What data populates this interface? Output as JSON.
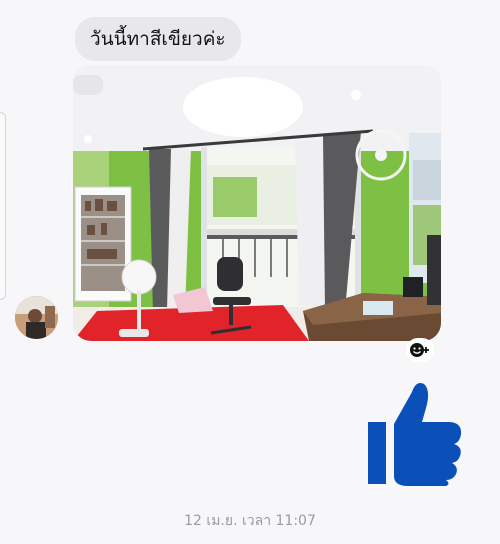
{
  "chat": {
    "message_text": "วันนี้ทาสีเขียวค่ะ",
    "timestamp": "12 เม.ย. เวลา 11:07"
  },
  "icons": {
    "reaction": "smiley-plus-icon",
    "like": "thumbs-up-icon"
  },
  "colors": {
    "bubble_bg": "#e8e8ec",
    "like_blue": "#0b4fb8",
    "wall_green": "#7dc043",
    "floor_red": "#e0242a"
  }
}
